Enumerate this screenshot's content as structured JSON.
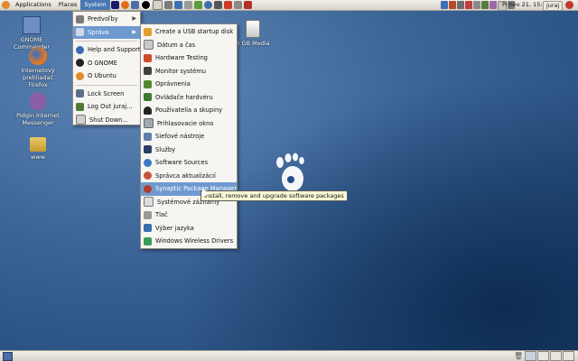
{
  "top_panel": {
    "menus": [
      "Applications",
      "Places",
      "System"
    ],
    "clock": "Pi nov 21, 15:31",
    "user": "juraj"
  },
  "desktop_icons": [
    "GNOME Commander",
    "Internetový prehliadač Firefox",
    "Pidgin Internet Messenger",
    "www",
    "8 GB Media"
  ],
  "system_menu": {
    "items": [
      {
        "label": "Predvoľby",
        "submenu": true,
        "icon": "preferences-icon"
      },
      {
        "label": "Správa",
        "submenu": true,
        "icon": "administration-icon",
        "active": true
      },
      {
        "label": "Help and Support",
        "icon": "help-icon"
      },
      {
        "label": "O GNOME",
        "icon": "gnome-foot-icon"
      },
      {
        "label": "O Ubuntu",
        "icon": "ubuntu-icon"
      },
      {
        "label": "Lock Screen",
        "icon": "lock-screen-icon"
      },
      {
        "label": "Log Out juraj...",
        "icon": "logout-icon"
      },
      {
        "label": "Shut Down...",
        "icon": "shutdown-icon"
      }
    ]
  },
  "admin_submenu": {
    "items": [
      "Create a USB startup disk",
      "Dátum a čas",
      "Hardware Testing",
      "Monitor systému",
      "Oprávnenia",
      "Ovládače hardvéru",
      "Používatelia a skupiny",
      "Prihlasovacie okno",
      "Sieťové nástroje",
      "Služby",
      "Software Sources",
      "Správca aktualizácií",
      "Synaptic Package Manager",
      "Systémové záznamy",
      "Tlač",
      "Výber jazyka",
      "Windows Wireless Drivers"
    ],
    "highlighted": "Synaptic Package Manager"
  },
  "tooltip": "Install, remove and upgrade software packages",
  "colors": {
    "highlight": "#6f9ad0",
    "desktop": "#2f5788",
    "panel": "#e6e3dc"
  }
}
